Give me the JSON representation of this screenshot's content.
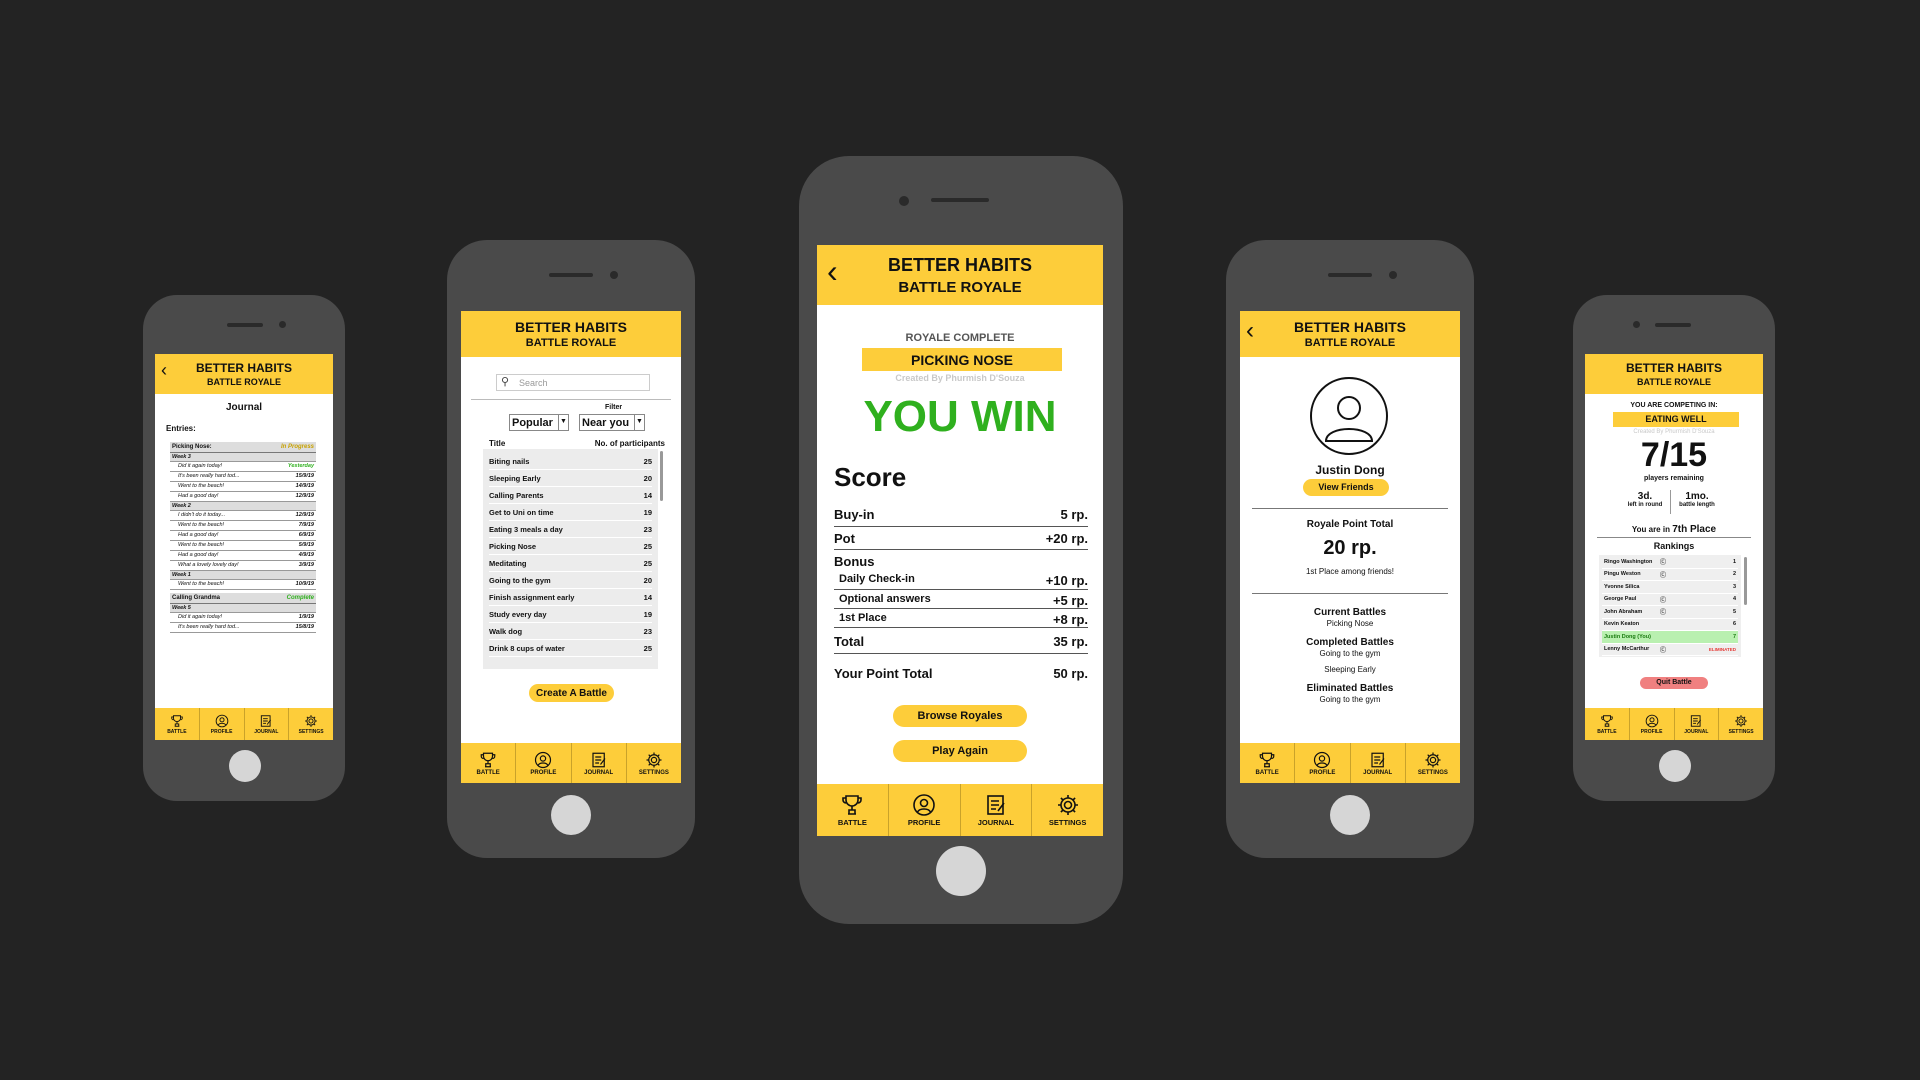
{
  "app": {
    "title": "BETTER HABITS",
    "subtitle": "BATTLE ROYALE"
  },
  "colors": {
    "accent": "#fdcd3a",
    "background": "#232323",
    "phone": "#4a4a4a",
    "win": "#2fb01e",
    "danger": "#e53935",
    "in_progress": "#c8a200"
  },
  "tabs": [
    {
      "label": "BATTLE",
      "icon": "trophy-icon"
    },
    {
      "label": "PROFILE",
      "icon": "profile-icon"
    },
    {
      "label": "JOURNAL",
      "icon": "journal-icon"
    },
    {
      "label": "SETTINGS",
      "icon": "gear-icon"
    }
  ],
  "journal": {
    "title": "Journal",
    "entries_label": "Entries:",
    "groups": [
      {
        "name": "Picking Nose:",
        "status": "In Progress",
        "weeks": [
          {
            "week": "Week 3",
            "items": [
              {
                "text": "Did it again today!",
                "date": "Yesterday"
              },
              {
                "text": "It's been really hard tod...",
                "date": "15/9/19"
              },
              {
                "text": "Went to the beach!",
                "date": "14/9/19"
              },
              {
                "text": "Had a good day!",
                "date": "12/9/19"
              }
            ]
          },
          {
            "week": "Week 2",
            "items": [
              {
                "text": "I didn't do it today...",
                "date": "12/9/19"
              },
              {
                "text": "Went to the beach!",
                "date": "7/9/19"
              },
              {
                "text": "Had a good day!",
                "date": "6/9/19"
              },
              {
                "text": "Went to the beach!",
                "date": "5/9/19"
              },
              {
                "text": "Had a good day!",
                "date": "4/9/19"
              },
              {
                "text": "What a lovely lovely day!",
                "date": "3/9/19"
              }
            ]
          },
          {
            "week": "Week 1",
            "items": [
              {
                "text": "Went to the beach!",
                "date": "10/9/19"
              }
            ]
          }
        ]
      },
      {
        "name": "Calling Grandma",
        "status": "Complete",
        "weeks": [
          {
            "week": "Week 5",
            "items": [
              {
                "text": "Did it again today!",
                "date": "1/9/19"
              },
              {
                "text": "It's been really hard tod...",
                "date": "15/8/19"
              }
            ]
          }
        ]
      }
    ]
  },
  "browse": {
    "search_placeholder": "Search",
    "filter_label": "Filter",
    "sort_value": "Popular",
    "filter_value": "Near you",
    "col_title": "Title",
    "col_participants": "No. of participants",
    "rows": [
      {
        "title": "Biting nails",
        "n": "25"
      },
      {
        "title": "Sleeping Early",
        "n": "20"
      },
      {
        "title": "Calling Parents",
        "n": "14"
      },
      {
        "title": "Get to Uni on time",
        "n": "19"
      },
      {
        "title": "Eating 3 meals a day",
        "n": "23"
      },
      {
        "title": "Picking Nose",
        "n": "25"
      },
      {
        "title": "Meditating",
        "n": "25"
      },
      {
        "title": "Going to the gym",
        "n": "20"
      },
      {
        "title": "Finish assignment early",
        "n": "14"
      },
      {
        "title": "Study every day",
        "n": "19"
      },
      {
        "title": "Walk dog",
        "n": "23"
      },
      {
        "title": "Drink 8 cups of water",
        "n": "25"
      }
    ],
    "create_button": "Create A Battle"
  },
  "result": {
    "royale_complete": "ROYALE COMPLETE",
    "battle_name": "PICKING NOSE",
    "created_by": "Created By Phurmish D'Souza",
    "headline": "YOU WIN",
    "score_title": "Score",
    "buyin_label": "Buy-in",
    "buyin_value": "5 rp.",
    "pot_label": "Pot",
    "pot_value": "+20 rp.",
    "bonus_label": "Bonus",
    "bonus_items": [
      {
        "label": "Daily Check-in",
        "value": "+10 rp."
      },
      {
        "label": "Optional answers",
        "value": "+5 rp."
      },
      {
        "label": "1st Place",
        "value": "+8 rp."
      }
    ],
    "total_label": "Total",
    "total_value": "35 rp.",
    "point_total_label": "Your Point Total",
    "point_total_value": "50 rp.",
    "browse_button": "Browse Royales",
    "play_again_button": "Play Again"
  },
  "profile": {
    "name": "Justin Dong",
    "view_friends": "View Friends",
    "royale_point_total_label": "Royale Point Total",
    "points": "20 rp.",
    "rank_note": "1st Place among friends!",
    "current_label": "Current Battles",
    "current": [
      "Picking Nose"
    ],
    "completed_label": "Completed Battles",
    "completed": [
      "Going to the gym",
      "Sleeping Early"
    ],
    "eliminated_label": "Eliminated Battles",
    "eliminated": [
      "Going to the gym"
    ]
  },
  "competing": {
    "competing_label": "YOU ARE COMPETING IN:",
    "battle_name": "EATING WELL",
    "created_by": "Created By Phurmish D'Souza",
    "remaining": "7/15",
    "remaining_label": "players remaining",
    "days_value": "3d.",
    "days_label": "left in round",
    "length_value": "1mo.",
    "length_label": "battle length",
    "place_prefix": "You are in",
    "place": "7th Place",
    "rankings_label": "Rankings",
    "rankings": [
      {
        "name": "Ringo Washington",
        "rank": "1",
        "icon": true
      },
      {
        "name": "Pingu Weston",
        "rank": "2",
        "icon": true
      },
      {
        "name": "Yvonne Silica",
        "rank": "3",
        "icon": false
      },
      {
        "name": "George Paul",
        "rank": "4",
        "icon": true
      },
      {
        "name": "John Abraham",
        "rank": "5",
        "icon": true
      },
      {
        "name": "Kevin Keaton",
        "rank": "6",
        "icon": false
      },
      {
        "name": "Justin Dong (You)",
        "rank": "7",
        "icon": false,
        "highlight": true
      },
      {
        "name": "Lenny McCarthur",
        "rank": "ELIMINATED",
        "icon": true,
        "eliminated": true
      }
    ],
    "quit_button": "Quit Battle"
  }
}
